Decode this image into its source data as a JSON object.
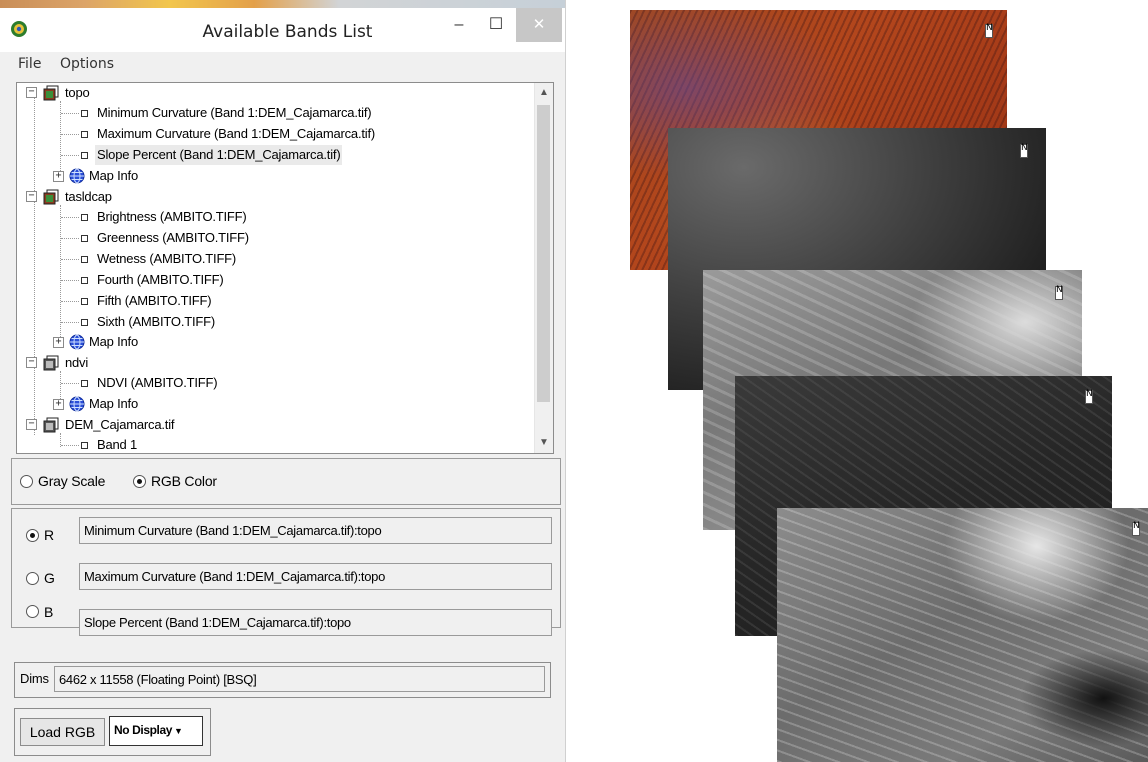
{
  "window": {
    "title": "Available Bands List",
    "controls": {
      "minimize": "–",
      "maximize": "☐",
      "close": "✕"
    }
  },
  "menu": {
    "file": "File",
    "options": "Options"
  },
  "tree": {
    "groups": [
      {
        "name": "topo",
        "items": [
          "Minimum Curvature (Band 1:DEM_Cajamarca.tif)",
          "Maximum Curvature (Band 1:DEM_Cajamarca.tif)",
          "Slope Percent (Band 1:DEM_Cajamarca.tif)"
        ],
        "map_info": "Map Info"
      },
      {
        "name": "tasldcap",
        "items": [
          "Brightness (AMBITO.TIFF)",
          "Greenness (AMBITO.TIFF)",
          "Wetness (AMBITO.TIFF)",
          "Fourth (AMBITO.TIFF)",
          "Fifth (AMBITO.TIFF)",
          "Sixth (AMBITO.TIFF)"
        ],
        "map_info": "Map Info"
      },
      {
        "name": "ndvi",
        "items": [
          "NDVI (AMBITO.TIFF)"
        ],
        "map_info": "Map Info"
      },
      {
        "name": "DEM_Cajamarca.tif",
        "items": [
          "Band 1"
        ]
      }
    ]
  },
  "mode": {
    "gray": "Gray Scale",
    "rgb": "RGB Color",
    "selected": "RGB Color"
  },
  "rgb": {
    "r": {
      "label": "R",
      "value": "Minimum Curvature (Band 1:DEM_Cajamarca.tif):topo"
    },
    "g": {
      "label": "G",
      "value": "Maximum Curvature (Band 1:DEM_Cajamarca.tif):topo"
    },
    "b": {
      "label": "B",
      "value": "Slope Percent (Band 1:DEM_Cajamarca.tif):topo"
    },
    "selected": "R"
  },
  "dims": {
    "label": "Dims",
    "value": "6462 x 11558 (Floating Point) [BSQ]"
  },
  "buttons": {
    "load": "Load RGB",
    "display": "No Display"
  },
  "icons": {
    "app": "envi-app-icon",
    "file": "raster-file-icon",
    "globe": "map-info-globe-icon",
    "north": "north-arrow-icon"
  },
  "colors": {
    "selection": "#eaeaea",
    "close_btn": "#c7c7c7",
    "globe": "#1a3fc0"
  }
}
